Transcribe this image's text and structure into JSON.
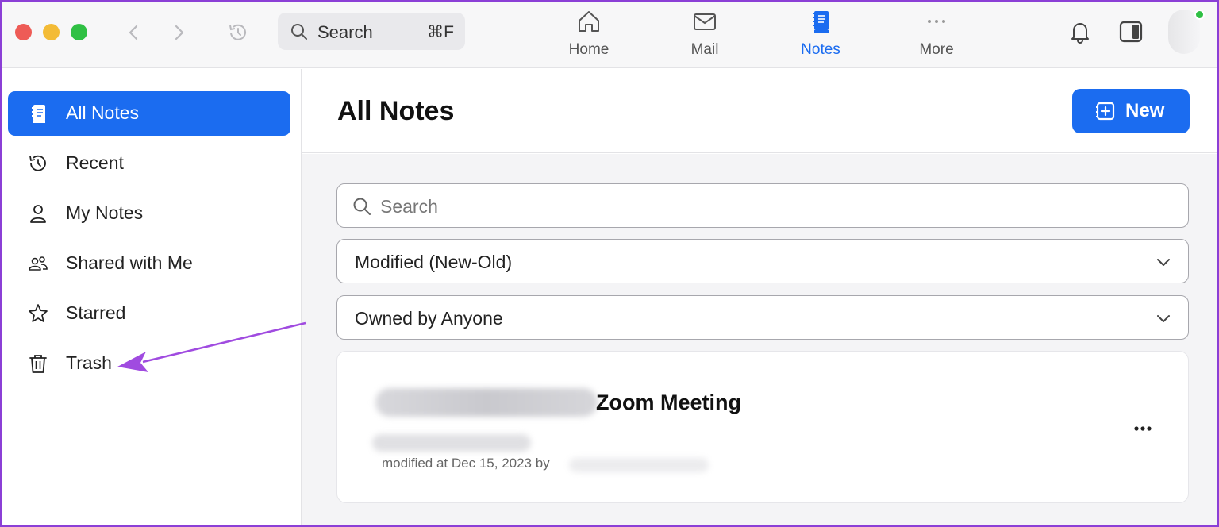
{
  "topbar": {
    "search_label": "Search",
    "search_shortcut": "⌘F",
    "tabs": [
      {
        "label": "Home",
        "icon": "home-icon",
        "active": false
      },
      {
        "label": "Mail",
        "icon": "mail-icon",
        "active": false
      },
      {
        "label": "Notes",
        "icon": "notes-icon",
        "active": true
      },
      {
        "label": "More",
        "icon": "more-dots-icon",
        "active": false
      }
    ],
    "accent_color": "#1b6cf0"
  },
  "sidebar": {
    "items": [
      {
        "label": "All Notes",
        "icon": "notes-icon",
        "active": true
      },
      {
        "label": "Recent",
        "icon": "history-icon",
        "active": false
      },
      {
        "label": "My Notes",
        "icon": "person-icon",
        "active": false
      },
      {
        "label": "Shared with Me",
        "icon": "people-icon",
        "active": false
      },
      {
        "label": "Starred",
        "icon": "star-icon",
        "active": false
      },
      {
        "label": "Trash",
        "icon": "trash-icon",
        "active": false
      }
    ]
  },
  "main": {
    "title": "All Notes",
    "new_button": "New",
    "search_placeholder": "Search",
    "sort_value": "Modified (New-Old)",
    "owner_value": "Owned by Anyone",
    "notes": [
      {
        "title": "Zoom Meeting",
        "meta": "modified at Dec 15, 2023 by"
      }
    ]
  },
  "annotation": {
    "arrow_color": "#a04be0",
    "points_to": "Trash"
  }
}
